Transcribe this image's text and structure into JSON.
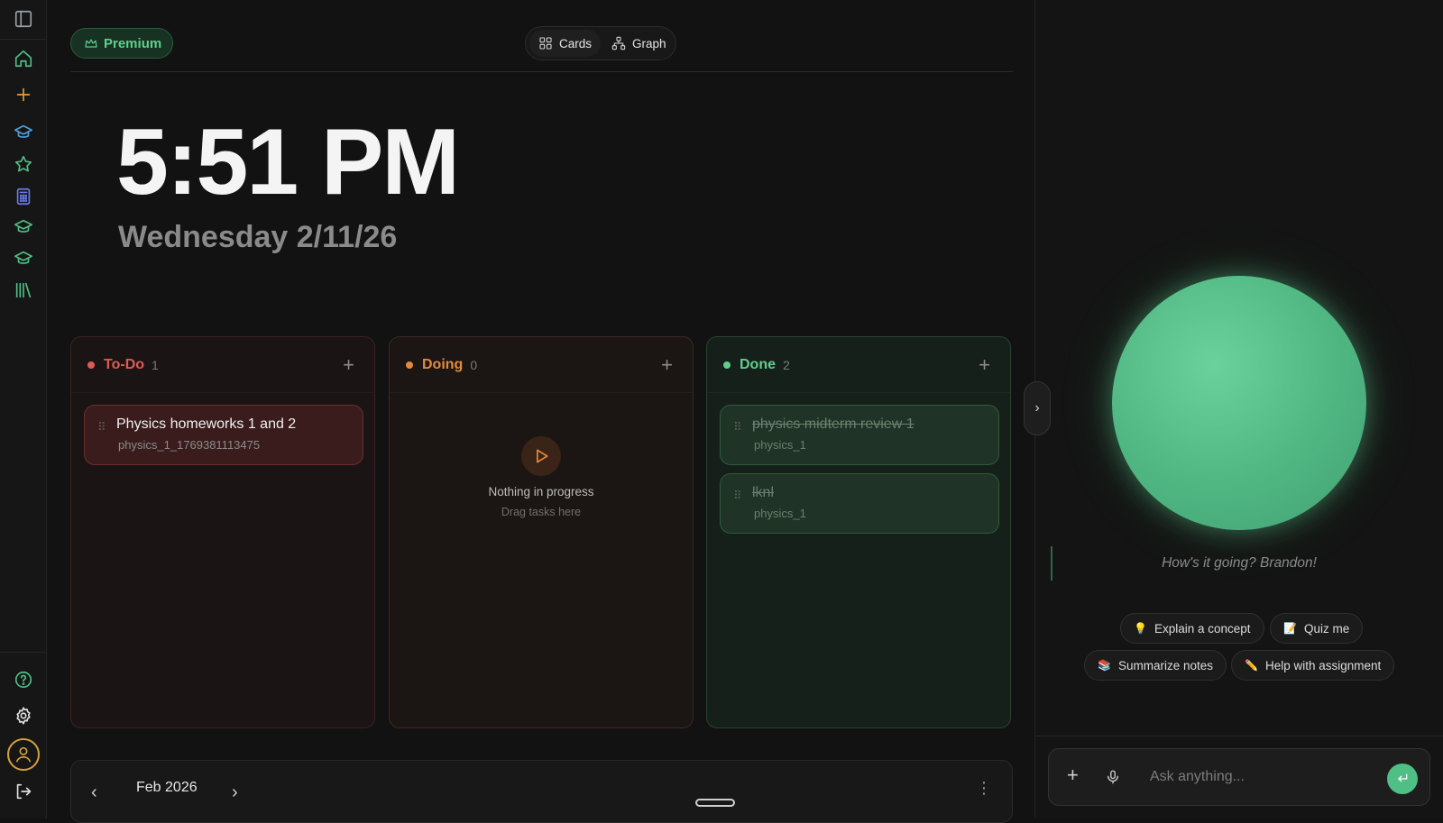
{
  "colors": {
    "accent_green": "#4fbf85",
    "todo_red": "#e05a52",
    "doing_orange": "#e58a3c",
    "done_green": "#5fcf8e",
    "avatar_ring": "#d4a13a"
  },
  "sidebar": {
    "top_icons": [
      "sidebar-toggle-icon",
      "home-icon",
      "plus-icon",
      "graduation-cap-icon",
      "star-icon",
      "calculator-icon",
      "graduation-cap-icon",
      "graduation-cap-icon",
      "library-icon"
    ],
    "bottom_icons": [
      "help-icon",
      "gear-icon",
      "user-icon",
      "logout-icon"
    ]
  },
  "header": {
    "premium_label": "Premium",
    "view_toggle": {
      "cards_label": "Cards",
      "graph_label": "Graph",
      "active": "Cards"
    }
  },
  "clock": {
    "time": "5:51 PM",
    "date": "Wednesday 2/11/26"
  },
  "board": {
    "todo": {
      "title": "To-Do",
      "count": "1",
      "cards": [
        {
          "title": "Physics homeworks 1 and 2",
          "subtitle": "physics_1_1769381113475"
        }
      ]
    },
    "doing": {
      "title": "Doing",
      "count": "0",
      "empty_title": "Nothing in progress",
      "empty_sub": "Drag tasks here"
    },
    "done": {
      "title": "Done",
      "count": "2",
      "cards": [
        {
          "title": "physics midterm review 1",
          "subtitle": "physics_1"
        },
        {
          "title": "lknl",
          "subtitle": "physics_1"
        }
      ]
    }
  },
  "calendar": {
    "month": "Feb 2026"
  },
  "assistant": {
    "greeting": "How's it going? Brandon!",
    "chips": [
      {
        "emoji": "💡",
        "label": "Explain a concept"
      },
      {
        "emoji": "📝",
        "label": "Quiz me"
      },
      {
        "emoji": "📚",
        "label": "Summarize notes"
      },
      {
        "emoji": "✏️",
        "label": "Help with assignment"
      }
    ],
    "input_placeholder": "Ask anything..."
  }
}
